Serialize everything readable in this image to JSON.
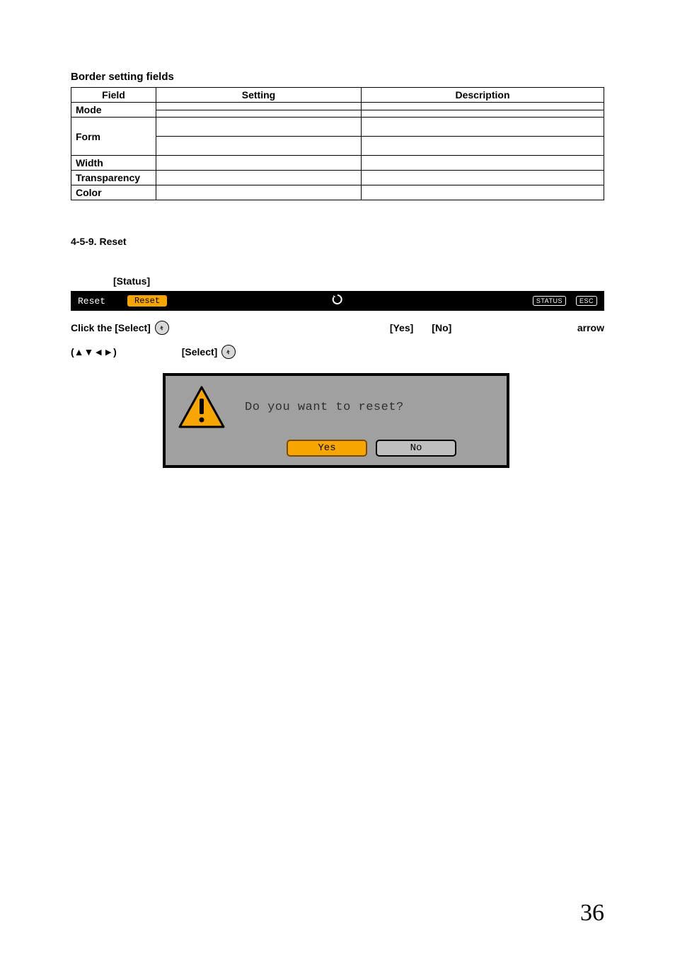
{
  "section_title": "Border setting fields",
  "table": {
    "headers": {
      "field": "Field",
      "setting": "Setting",
      "description": "Description"
    },
    "rows": [
      {
        "field": "Mode",
        "span": 2,
        "cells": [
          {
            "s": "",
            "d": ""
          },
          {
            "s": "",
            "d": ""
          }
        ]
      },
      {
        "field": "Form",
        "span": 2,
        "cells": [
          {
            "s": "",
            "d": ""
          },
          {
            "s": "",
            "d": ""
          }
        ]
      },
      {
        "field": "Width",
        "span": 1,
        "cells": [
          {
            "s": "",
            "d": ""
          }
        ]
      },
      {
        "field": "Transparency",
        "span": 1,
        "cells": [
          {
            "s": "",
            "d": ""
          }
        ]
      },
      {
        "field": "Color",
        "span": 1,
        "cells": [
          {
            "s": "",
            "d": ""
          }
        ]
      }
    ]
  },
  "subsection": "4-5-9. Reset",
  "status_label": "[Status]",
  "osd": {
    "left_text": "Reset",
    "chip": "Reset",
    "icon_name": "reset-arrow-icon",
    "badges": {
      "status": "STATUS",
      "esc": "ESC"
    }
  },
  "instr1": {
    "pre": "Click the [Select]",
    "yes": "[Yes]",
    "no": "[No]",
    "arrow_word": "arrow"
  },
  "instr2": {
    "arrows": "(▲▼◄►)",
    "select": "[Select]"
  },
  "dialog": {
    "message": "Do you want to reset?",
    "yes": "Yes",
    "no": "No"
  },
  "page_number": "36"
}
